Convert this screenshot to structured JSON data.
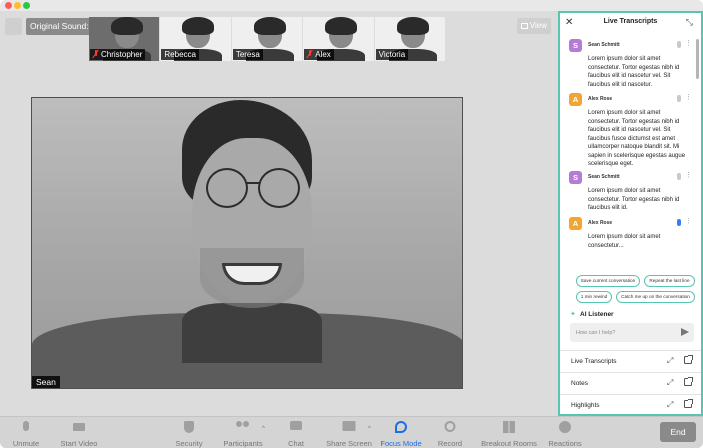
{
  "header": {
    "original_sound": "Original Sound: On",
    "view_label": "View"
  },
  "thumbnails": [
    {
      "name": "Christopher",
      "muted": true
    },
    {
      "name": "Rebecca",
      "muted": false
    },
    {
      "name": "Teresa",
      "muted": false
    },
    {
      "name": "Alex",
      "muted": true
    },
    {
      "name": "Victoria",
      "muted": false
    }
  ],
  "main_video": {
    "name": "Sean"
  },
  "panel": {
    "title": "Live Transcripts",
    "close_icon": "✕",
    "collapse_icon": "⤡",
    "messages": [
      {
        "initial": "S",
        "name": "Sean Schmitt",
        "text": "Lorem ipsum dolor sit amet consectetur. Tortor egestas nibh id faucibus elit id nascetur vel. Sit faucibus elit id nascetur."
      },
      {
        "initial": "A",
        "name": "Alex Rose",
        "text": "Lorem ipsum dolor sit amet consectetur. Tortor egestas nibh id faucibus elit id nascetur vel. Sit faucibus fusce dictumst est amet ullamcorper natoque blandit sit. Mi sapien in scelerisque egestas augue scelerisque eget."
      },
      {
        "initial": "S",
        "name": "Sean Schmitt",
        "text": "Lorem ipsum dolor sit amet consectetur. Tortor egestas nibh id faucibus elit id."
      },
      {
        "initial": "A",
        "name": "Alex Rose",
        "text": "Lorem ipsum dolor sit amet consectetur..."
      }
    ],
    "chips": [
      "Save current conversation",
      "Repeat the last line",
      "1 min rewind",
      "Catch me up on the conversation"
    ],
    "ai_listener": "AI Listener",
    "ask_placeholder": "How can I help?",
    "sections": [
      "Live Transcripts",
      "Notes",
      "Highlights"
    ]
  },
  "toolbar": {
    "buttons": [
      "Unmute",
      "Start Video",
      "Security",
      "Participants",
      "Chat",
      "Share Screen",
      "Focus Mode",
      "Record",
      "Breakout Rooms",
      "Reactions"
    ],
    "end_label": "End"
  },
  "colors": {
    "accent": "#59c4b0",
    "focus_active": "#1b6fe6",
    "avatar_s": "#b57cd4",
    "avatar_a": "#f1a533"
  }
}
